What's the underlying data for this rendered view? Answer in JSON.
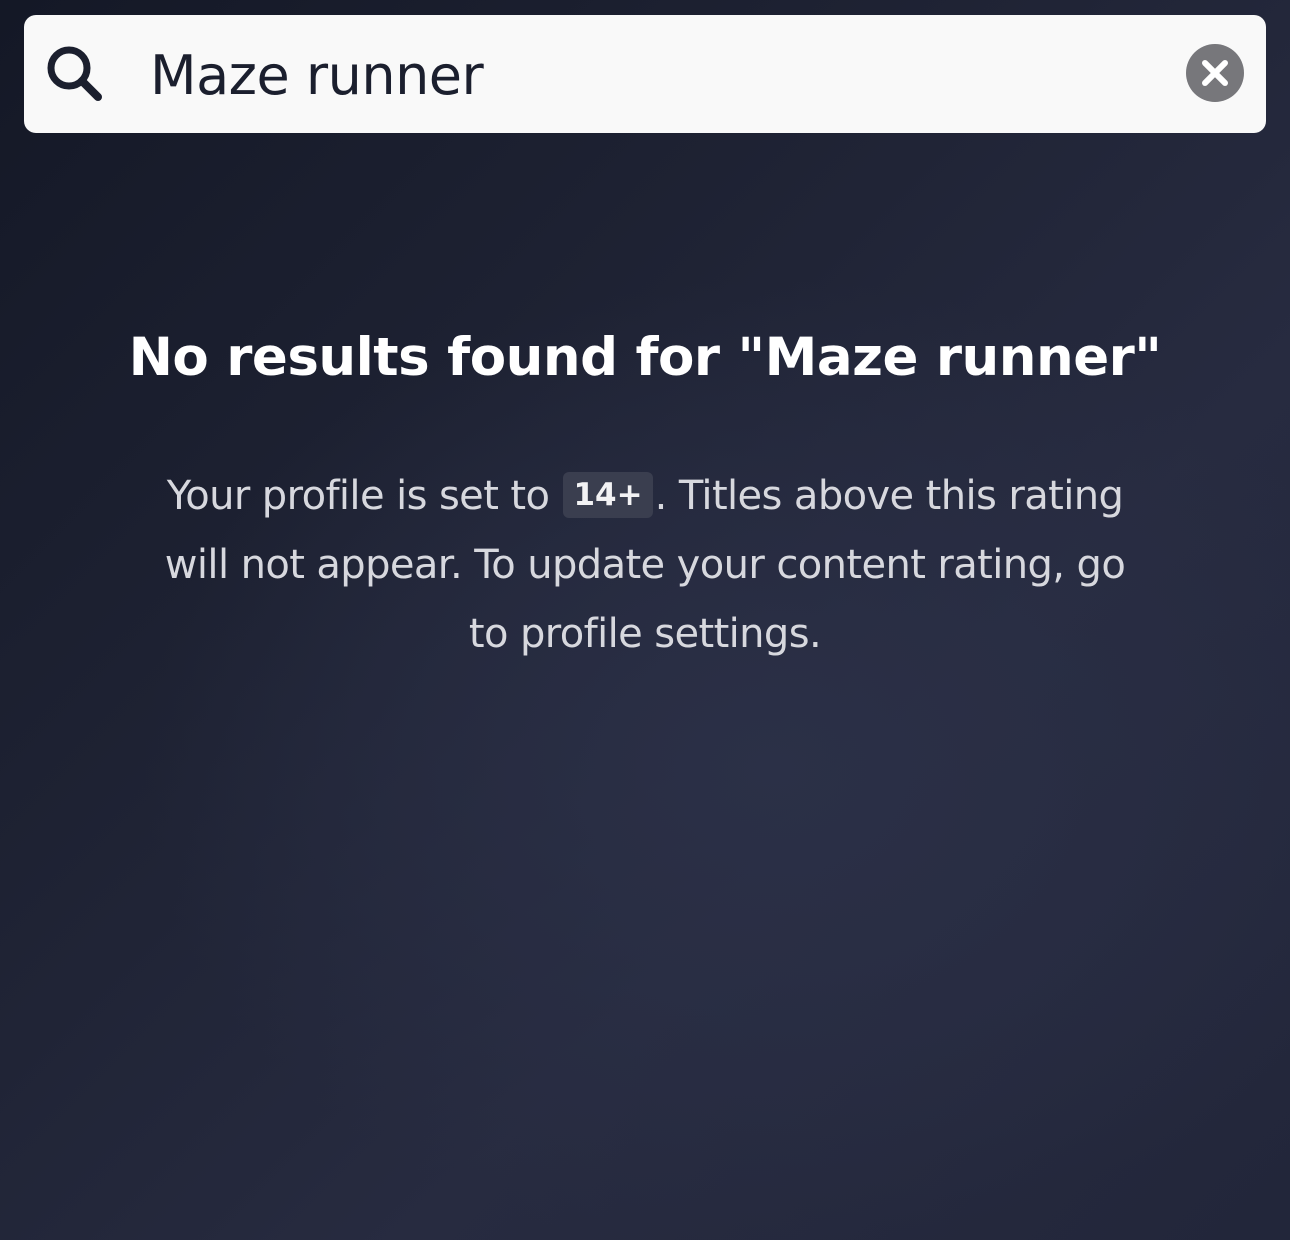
{
  "search": {
    "value": "Maze runner",
    "placeholder": ""
  },
  "results": {
    "title": "No results found for \"Maze runner\"",
    "message_before": "Your profile is set to ",
    "rating_badge": "14+",
    "message_after": ". Titles above this rating will not appear. To update your content rating, go to profile settings."
  },
  "icons": {
    "search": "search-icon",
    "clear": "close-icon"
  },
  "colors": {
    "search_bar_bg": "#f9f9f9",
    "search_text": "#1b1f2e",
    "clear_button_bg": "#77777b",
    "background": "#22263a",
    "title_text": "#ffffff",
    "message_text": "#d7d8de",
    "badge_bg": "#3a3e4f"
  }
}
